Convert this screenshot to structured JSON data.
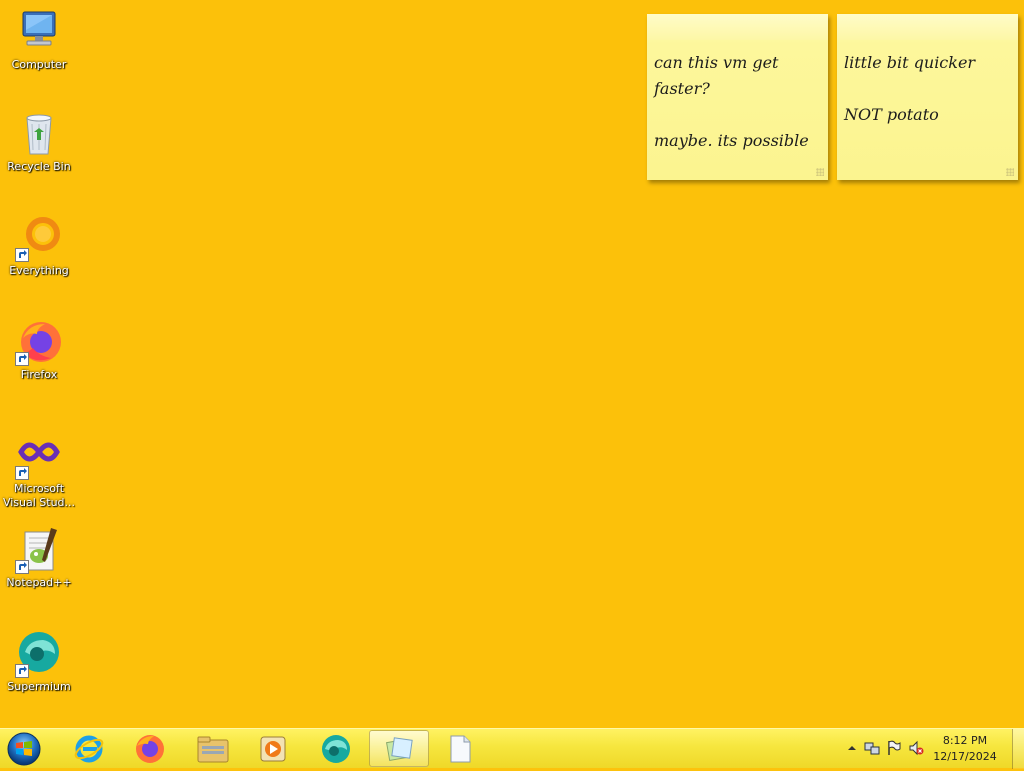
{
  "desktop": {
    "background_color": "#fcc10a",
    "icons": [
      {
        "label": "Computer",
        "icon": "computer-icon"
      },
      {
        "label": "Recycle Bin",
        "icon": "recycle-bin-icon"
      },
      {
        "label": "Everything",
        "icon": "everything-icon"
      },
      {
        "label": "Firefox",
        "icon": "firefox-icon"
      },
      {
        "label": "Microsoft Visual Stud...",
        "icon": "visual-studio-icon"
      },
      {
        "label": "Notepad++",
        "icon": "notepadpp-icon"
      },
      {
        "label": "Supermium",
        "icon": "supermium-icon"
      }
    ]
  },
  "sticky_notes": [
    {
      "text": "can this vm get\nfaster?\n\nmaybe. its possible"
    },
    {
      "text": "little bit quicker\n\nNOT potato"
    }
  ],
  "taskbar": {
    "start": {
      "icon": "windows-start-icon"
    },
    "pinned": [
      {
        "name": "internet-explorer",
        "icon": "internet-explorer-icon"
      },
      {
        "name": "firefox",
        "icon": "firefox-icon"
      },
      {
        "name": "windows-explorer",
        "icon": "folder-icon"
      },
      {
        "name": "media-player",
        "icon": "media-player-icon"
      },
      {
        "name": "supermium",
        "icon": "supermium-icon"
      },
      {
        "name": "sticky-notes",
        "icon": "sticky-notes-icon",
        "active": true
      },
      {
        "name": "blank-document",
        "icon": "document-icon"
      }
    ],
    "tray": {
      "time": "8:12 PM",
      "date": "12/17/2024",
      "icons": [
        "show-hidden-icons-arrow",
        "network-icon",
        "action-center-flag-icon",
        "volume-muted-icon"
      ]
    }
  }
}
